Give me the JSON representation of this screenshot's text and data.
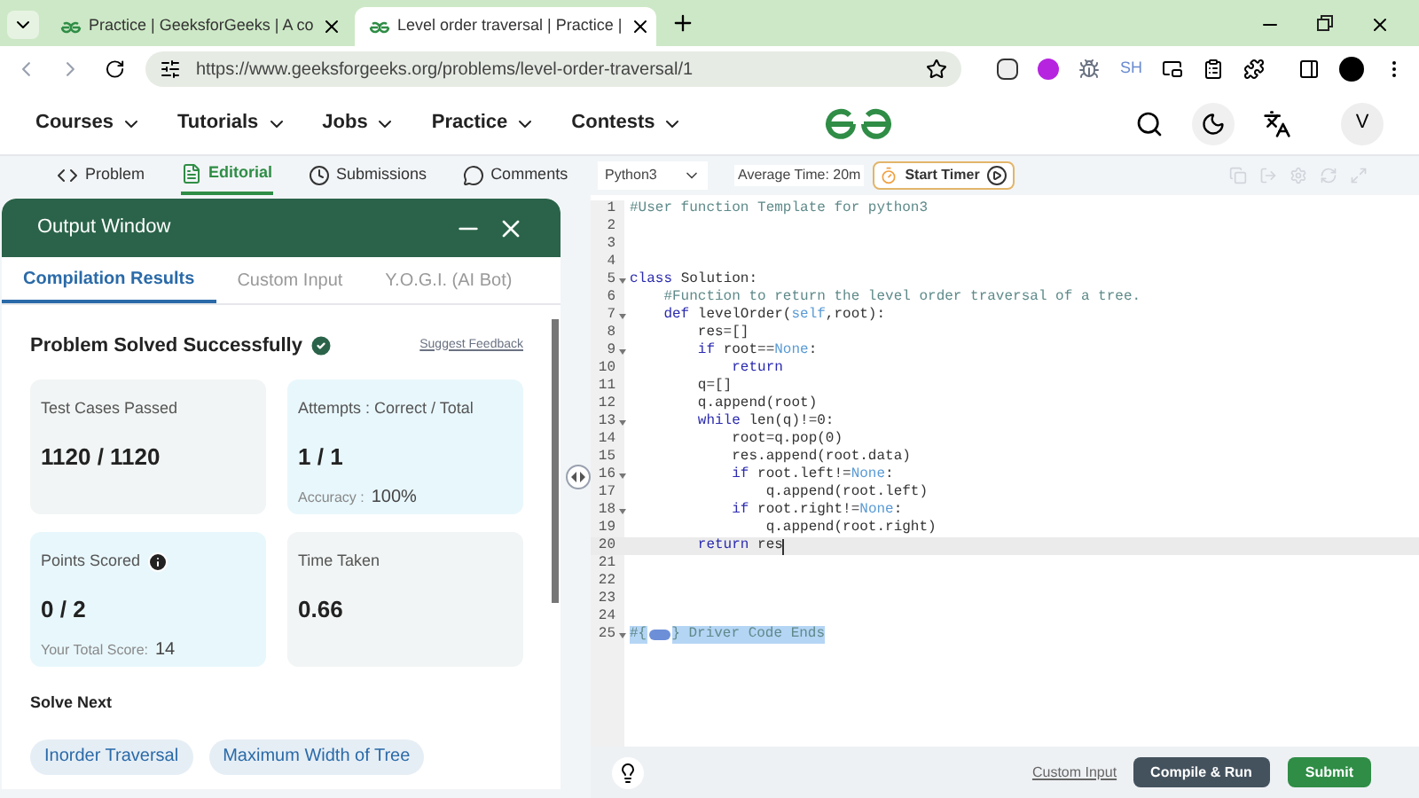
{
  "browser": {
    "tabs": [
      {
        "title": "Practice | GeeksforGeeks | A co",
        "selected": false
      },
      {
        "title": "Level order traversal | Practice |",
        "selected": true
      }
    ],
    "url": "https://www.geeksforgeeks.org/problems/level-order-traversal/1",
    "extension_label": "SH"
  },
  "site_nav": {
    "items": [
      "Courses",
      "Tutorials",
      "Jobs",
      "Practice",
      "Contests"
    ],
    "avatar": "V"
  },
  "problem_tabs": [
    {
      "label": "Problem",
      "selected": false,
      "kind": "code"
    },
    {
      "label": "Editorial",
      "selected": true,
      "kind": "doc"
    },
    {
      "label": "Submissions",
      "selected": false,
      "kind": "clock"
    },
    {
      "label": "Comments",
      "selected": false,
      "kind": "chat"
    }
  ],
  "output_window": {
    "title": "Output Window",
    "tabs": [
      {
        "label": "Compilation Results",
        "selected": true
      },
      {
        "label": "Custom Input",
        "selected": false
      },
      {
        "label": "Y.O.G.I. (AI Bot)",
        "selected": false
      }
    ],
    "status": "Problem Solved Successfully",
    "feedback_link": "Suggest Feedback",
    "cards": [
      {
        "label": "Test Cases Passed",
        "value": "1120 / 1120",
        "color": "#f2f5f5",
        "info": false
      },
      {
        "label": "Attempts : Correct / Total",
        "value": "1 / 1",
        "sub_label": "Accuracy :",
        "sub_value": "100%",
        "color": "#e8f7fc",
        "info": false
      },
      {
        "label": "Points Scored",
        "value": "0 / 2",
        "sub_label": "Your Total Score:",
        "sub_value": "14",
        "color": "#e8f7fc",
        "info": true
      },
      {
        "label": "Time Taken",
        "value": "0.66",
        "color": "#f2f5f5",
        "info": false
      }
    ],
    "solve_next_title": "Solve Next",
    "solve_next": [
      "Inorder Traversal",
      "Maximum Width of Tree"
    ]
  },
  "editor": {
    "language": "Python3",
    "average_time": "Average Time: 20m",
    "timer_button": "Start Timer",
    "lines": [
      {
        "number": "1",
        "fold": false,
        "current": false,
        "tokens": [
          {
            "kind": "comment",
            "text": "#User function Template for python3"
          }
        ]
      },
      {
        "number": "2",
        "fold": false,
        "current": false
      },
      {
        "number": "3",
        "fold": false,
        "current": false
      },
      {
        "number": "4",
        "fold": false,
        "current": false
      },
      {
        "number": "5",
        "fold": true,
        "current": false,
        "tokens": [
          {
            "kind": "keyword",
            "text": "class"
          },
          {
            "kind": "plain",
            "text": " Solution:"
          }
        ]
      },
      {
        "number": "6",
        "fold": false,
        "current": false,
        "tokens": [
          {
            "kind": "comment",
            "text": "    #Function to return the level order traversal of a tree."
          }
        ]
      },
      {
        "number": "7",
        "fold": true,
        "current": false,
        "tokens": [
          {
            "kind": "keyword",
            "text": "    def"
          },
          {
            "kind": "plain",
            "text": " levelOrder("
          },
          {
            "kind": "const",
            "text": "self"
          },
          {
            "kind": "plain",
            "text": ",root):"
          }
        ]
      },
      {
        "number": "8",
        "fold": false,
        "current": false,
        "tokens": [
          {
            "kind": "plain",
            "text": "        res=[]"
          }
        ]
      },
      {
        "number": "9",
        "fold": true,
        "current": false,
        "tokens": [
          {
            "kind": "keyword",
            "text": "        if"
          },
          {
            "kind": "plain",
            "text": " root=="
          },
          {
            "kind": "const",
            "text": "None"
          },
          {
            "kind": "plain",
            "text": ":"
          }
        ]
      },
      {
        "number": "10",
        "fold": false,
        "current": false,
        "tokens": [
          {
            "kind": "keyword",
            "text": "            return"
          }
        ]
      },
      {
        "number": "11",
        "fold": false,
        "current": false,
        "tokens": [
          {
            "kind": "plain",
            "text": "        q=[]"
          }
        ]
      },
      {
        "number": "12",
        "fold": false,
        "current": false,
        "tokens": [
          {
            "kind": "plain",
            "text": "        q.append(root)"
          }
        ]
      },
      {
        "number": "13",
        "fold": true,
        "current": false,
        "tokens": [
          {
            "kind": "keyword",
            "text": "        while"
          },
          {
            "kind": "plain",
            "text": " len(q)!=0:"
          }
        ]
      },
      {
        "number": "14",
        "fold": false,
        "current": false,
        "tokens": [
          {
            "kind": "plain",
            "text": "            root=q.pop(0)"
          }
        ]
      },
      {
        "number": "15",
        "fold": false,
        "current": false,
        "tokens": [
          {
            "kind": "plain",
            "text": "            res.append(root.data)"
          }
        ]
      },
      {
        "number": "16",
        "fold": true,
        "current": false,
        "tokens": [
          {
            "kind": "keyword",
            "text": "            if"
          },
          {
            "kind": "plain",
            "text": " root.left!="
          },
          {
            "kind": "const",
            "text": "None"
          },
          {
            "kind": "plain",
            "text": ":"
          }
        ]
      },
      {
        "number": "17",
        "fold": false,
        "current": false,
        "tokens": [
          {
            "kind": "plain",
            "text": "                q.append(root.left)"
          }
        ]
      },
      {
        "number": "18",
        "fold": true,
        "current": false,
        "tokens": [
          {
            "kind": "keyword",
            "text": "            if"
          },
          {
            "kind": "plain",
            "text": " root.right!="
          },
          {
            "kind": "const",
            "text": "None"
          },
          {
            "kind": "plain",
            "text": ":"
          }
        ]
      },
      {
        "number": "19",
        "fold": false,
        "current": false,
        "tokens": [
          {
            "kind": "plain",
            "text": "                q.append(root.right)"
          }
        ]
      },
      {
        "number": "20",
        "fold": false,
        "current": true,
        "tokens": [
          {
            "kind": "keyword",
            "text": "        return"
          },
          {
            "kind": "plain",
            "text": " res"
          }
        ]
      },
      {
        "number": "21",
        "fold": false,
        "current": false
      },
      {
        "number": "22",
        "fold": false,
        "current": false
      },
      {
        "number": "23",
        "fold": false,
        "current": false
      },
      {
        "number": "24",
        "fold": false,
        "current": false
      },
      {
        "number": "25",
        "fold": true,
        "current": false,
        "tokens": [
          {
            "kind": "selected",
            "text": "#{"
          },
          {
            "kind": "widget"
          },
          {
            "kind": "selected",
            "text": "} Driver Code Ends"
          }
        ]
      }
    ],
    "custom_input_link": "Custom Input",
    "compile_button": "Compile & Run",
    "submit_button": "Submit"
  }
}
